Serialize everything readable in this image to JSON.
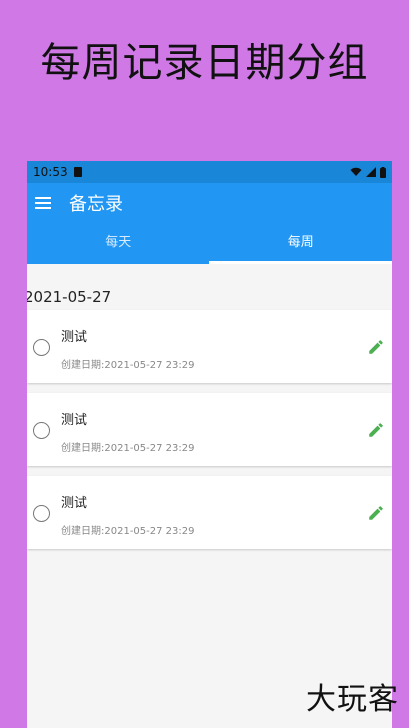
{
  "banner": {
    "text": "每周记录日期分组"
  },
  "status": {
    "time": "10:53"
  },
  "app": {
    "title": "备忘录"
  },
  "tabs": [
    {
      "label": "每天"
    },
    {
      "label": "每周"
    }
  ],
  "group": {
    "date": "2021-05-27"
  },
  "memos": [
    {
      "title": "测试",
      "created_label": "创建日期:",
      "created": "2021-05-27 23:29"
    },
    {
      "title": "测试",
      "created_label": "创建日期:",
      "created": "2021-05-27 23:29"
    },
    {
      "title": "测试",
      "created_label": "创建日期:",
      "created": "2021-05-27 23:29"
    }
  ],
  "watermark": {
    "text": "大玩客"
  },
  "colors": {
    "primary": "#2196f3",
    "edit": "#4caf50",
    "background": "#cf78e6"
  }
}
